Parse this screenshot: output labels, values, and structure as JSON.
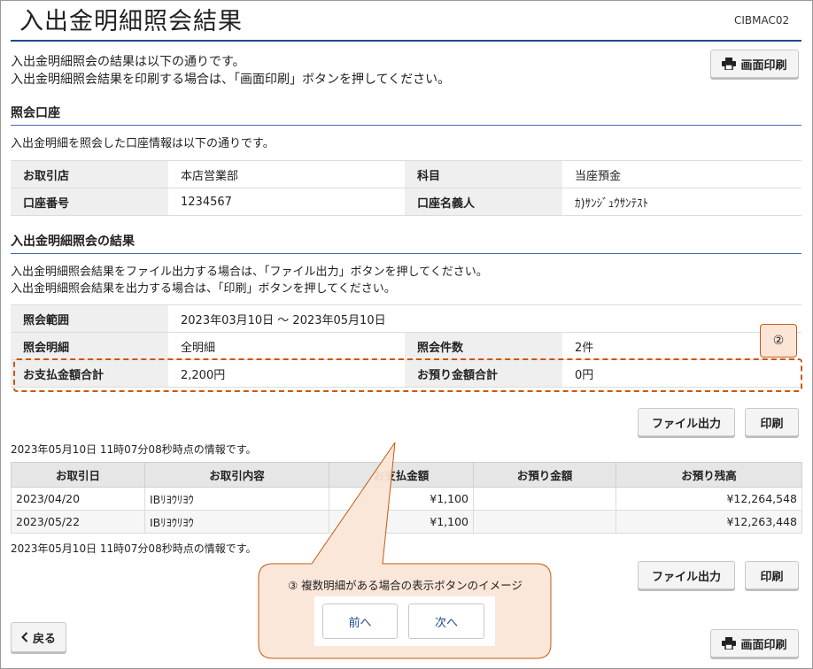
{
  "header": {
    "title": "入出金明細照会結果",
    "code": "CIBMAC02"
  },
  "intro": {
    "line1": "入出金明細照会の結果は以下の通りです。",
    "line2": "入出金明細照会結果を印刷する場合は、「画面印刷」ボタンを押してください。"
  },
  "print_screen_label": "画面印刷",
  "account_section": {
    "title": "照会口座",
    "desc": "入出金明細を照会した口座情報は以下の通りです。",
    "branch_label": "お取引店",
    "branch_value": "本店営業部",
    "subject_label": "科目",
    "subject_value": "当座預金",
    "number_label": "口座番号",
    "number_value": "1234567",
    "holder_label": "口座名義人",
    "holder_value": "ｶ)ｻﾝｼﾞｭｳｻﾝﾃｽﾄ"
  },
  "result_section": {
    "title": "入出金明細照会の結果",
    "desc1": "入出金明細照会結果をファイル出力する場合は、「ファイル出力」ボタンを押してください。",
    "desc2": "入出金明細照会結果を出力する場合は、「印刷」ボタンを押してください。",
    "range_label": "照会範囲",
    "range_value": "2023年03月10日 〜 2023年05月10日",
    "detail_label": "照会明細",
    "detail_value": "全明細",
    "count_label": "照会件数",
    "count_value": "2件",
    "payment_total_label": "お支払金額合計",
    "payment_total_value": "2,200円",
    "deposit_total_label": "お預り金額合計",
    "deposit_total_value": "0円"
  },
  "annotation_2": "②",
  "annotation_3": "③ 複数明細がある場合の表示ボタンのイメージ",
  "file_output_label": "ファイル出力",
  "print_label": "印刷",
  "timestamp": "2023年05月10日 11時07分08秒時点の情報です。",
  "transactions": {
    "headers": [
      "お取引日",
      "お取引内容",
      "お支払金額",
      "お預り金額",
      "お預り残高"
    ],
    "rows": [
      {
        "date": "2023/04/20",
        "content": "IBﾘﾖｳﾘﾖｳ",
        "payment": "¥1,100",
        "deposit": "",
        "balance": "¥12,264,548"
      },
      {
        "date": "2023/05/22",
        "content": "IBﾘﾖｳﾘﾖｳ",
        "payment": "¥1,100",
        "deposit": "",
        "balance": "¥12,263,448"
      }
    ]
  },
  "pager": {
    "prev": "前へ",
    "next": "次へ"
  },
  "back_label": "戻る",
  "colors": {
    "accent": "#1f4a8a",
    "callout_fill": "#fbe5d6",
    "callout_border": "#c55a11"
  },
  "icons": {
    "print": "printer-icon",
    "back": "chevron-left-icon"
  }
}
